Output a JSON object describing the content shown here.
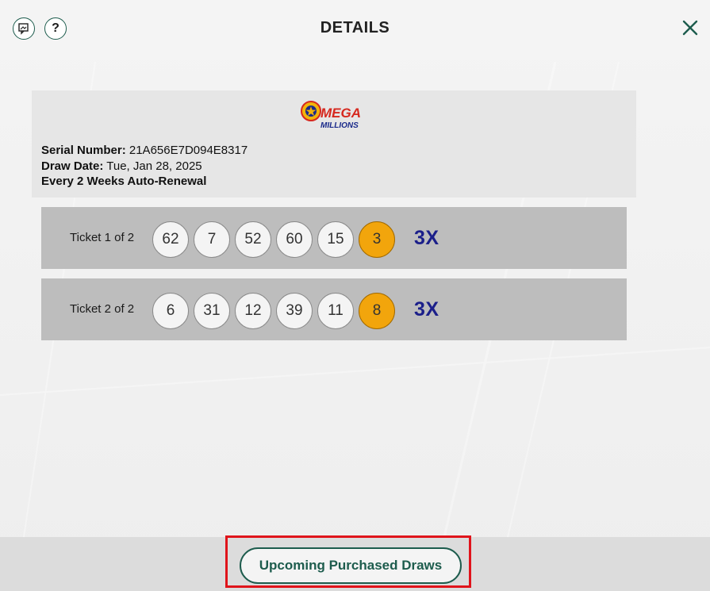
{
  "header": {
    "title": "DETAILS",
    "chat_icon": "chat-image-icon",
    "help_icon_glyph": "?",
    "close_icon": "close-icon"
  },
  "logo": {
    "line1": "MEGA",
    "line2": "MILLIONS"
  },
  "info": {
    "serial_label": "Serial Number:",
    "serial_value": "21A656E7D094E8317",
    "draw_date_label": "Draw Date:",
    "draw_date_value": "Tue, Jan 28, 2025",
    "renewal": "Every 2 Weeks Auto-Renewal"
  },
  "tickets": [
    {
      "label": "Ticket 1 of 2",
      "numbers": [
        "62",
        "7",
        "52",
        "60",
        "15"
      ],
      "mega_ball": "3",
      "multiplier": "3X"
    },
    {
      "label": "Ticket 2 of 2",
      "numbers": [
        "6",
        "31",
        "12",
        "39",
        "11"
      ],
      "mega_ball": "8",
      "multiplier": "3X"
    }
  ],
  "footer": {
    "upcoming_button": "Upcoming Purchased Draws"
  },
  "colors": {
    "accent_green": "#1d5c4d",
    "mega_ball": "#f2a50c",
    "multiplier": "#1b1f8a",
    "highlight_red": "#e0141b"
  }
}
